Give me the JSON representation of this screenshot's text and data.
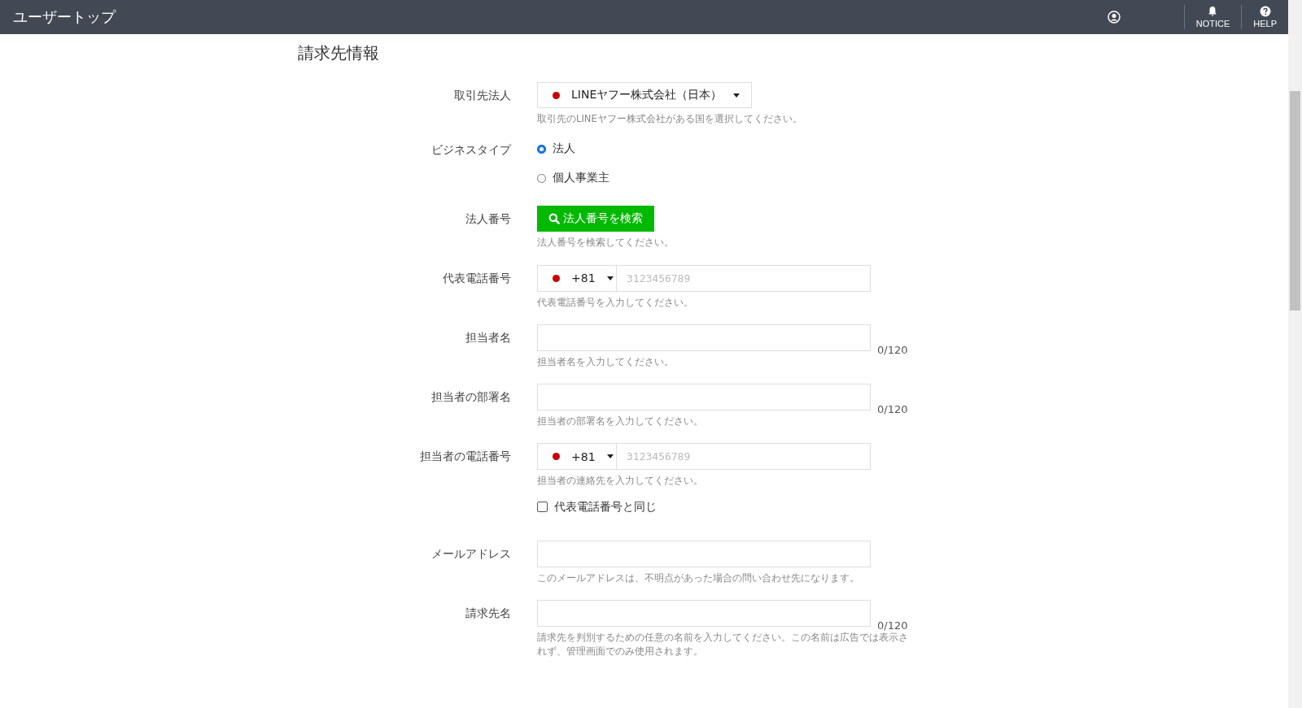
{
  "header": {
    "title": "ユーザートップ",
    "notice": "NOTICE",
    "help": "HELP"
  },
  "section_title": "請求先情報",
  "fields": [
    {
      "kind": "select",
      "label": "取引先法人",
      "value": "LINEヤフー株式会社（日本）",
      "help": "取引先のLINEヤフー株式会社がある国を選択してください。"
    },
    {
      "kind": "radio",
      "label": "ビジネスタイプ",
      "options": [
        {
          "label": "法人",
          "selected": true
        },
        {
          "label": "個人事業主",
          "selected": false
        }
      ]
    },
    {
      "kind": "button",
      "label": "法人番号",
      "button": "法人番号を検索",
      "help": "法人番号を検索してください。"
    },
    {
      "kind": "phone",
      "label": "代表電話番号",
      "code": "+81",
      "placeholder": "3123456789",
      "help": "代表電話番号を入力してください。"
    },
    {
      "kind": "text",
      "label": "担当者名",
      "counter": "0/120",
      "help": "担当者名を入力してください。"
    },
    {
      "kind": "text",
      "label": "担当者の部署名",
      "counter": "0/120",
      "help": "担当者の部署名を入力してください。"
    },
    {
      "kind": "phone",
      "label": "担当者の電話番号",
      "code": "+81",
      "placeholder": "3123456789",
      "help": "担当者の連絡先を入力してください。",
      "checkbox": {
        "label": "代表電話番号と同じ",
        "checked": false
      }
    },
    {
      "kind": "text",
      "label": "メールアドレス",
      "help": "このメールアドレスは、不明点があった場合の問い合わせ先になります。"
    },
    {
      "kind": "text",
      "label": "請求先名",
      "counter": "0/120",
      "help": "請求先を判別するための任意の名前を入力してください。この名前は広告では表示されず、管理画面でのみ使用されます。"
    }
  ]
}
